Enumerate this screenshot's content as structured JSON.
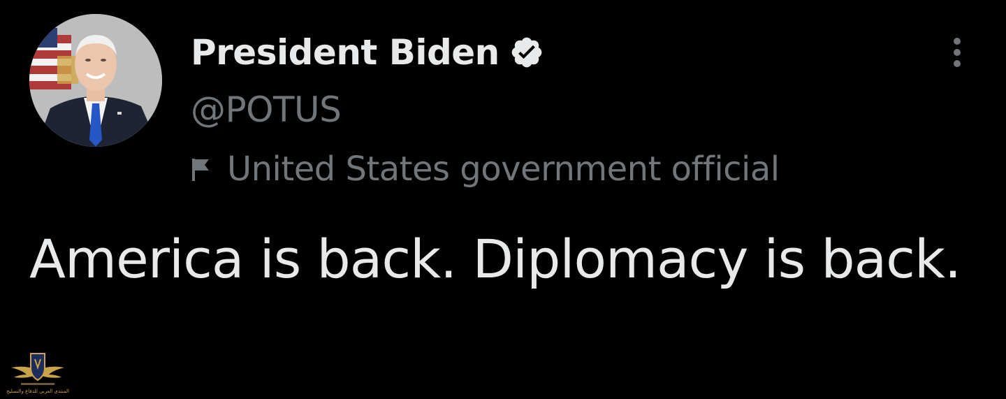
{
  "tweet": {
    "author": {
      "display_name": "President Biden",
      "handle": "@POTUS",
      "verified": true,
      "avatar_icon": "president-portrait-avatar",
      "label_icon": "flag-icon",
      "label": "United States government official"
    },
    "text": "America is back. Diplomacy is back.",
    "more_icon": "more-options-icon"
  },
  "watermark": {
    "caption": "المنتدى العربي للدفاع والتسليح",
    "logo_icon": "forum-shield-logo"
  },
  "colors": {
    "background": "#000000",
    "primary_text": "#e7e9ea",
    "secondary_text": "#71767b",
    "badge": "#e7e9ea"
  }
}
